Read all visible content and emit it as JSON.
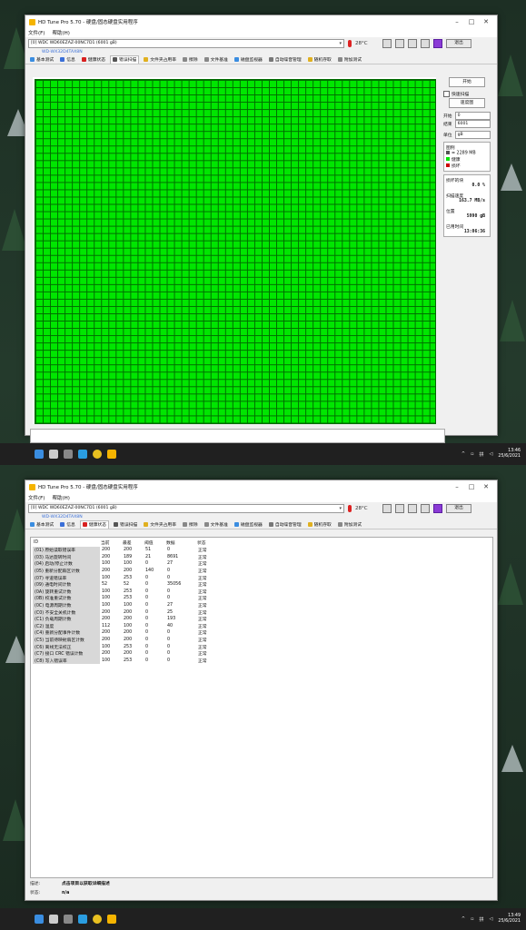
{
  "window_title": "HD Tune Pro 5.70 - 硬盘/固态硬盘实用程序",
  "menu": [
    "文件(F)",
    "帮助(H)"
  ],
  "drive": {
    "select": "[0]  WDC WD60EZAZ-00NC7D1  (6001 gB)",
    "temperature": "28°C",
    "serial": "WD-WX32D4TAX8N"
  },
  "exit_label": "退出",
  "tabs": [
    "基本测试",
    "信息",
    "健康状态",
    "错误扫描",
    "文件夹占用率",
    "擦除",
    "文件基准",
    "磁盘监视器",
    "自动噪音管理",
    "随机存取",
    "附加测试"
  ],
  "scan": {
    "start_button": "开始",
    "quick_scan": "快速扫描",
    "speed_map": "速度图",
    "start_label": "开始",
    "start_value": "0",
    "end_label": "结束",
    "end_value": "6001",
    "unit_label": "单位",
    "unit_value": "gB",
    "legend_title": "图例",
    "legend_block": "= 2289 MB",
    "legend_ok": "健康",
    "legend_bad": "损坏",
    "damaged_label": "损坏的块",
    "damaged_value": "0.0 %",
    "speed_label": "扫描速度",
    "speed_value": "163.7 MB/s",
    "position_label": "位置",
    "position_value": "5990 gB",
    "elapsed_label": "已用时间",
    "elapsed_value": "13:06:36",
    "colors": {
      "ok": "#00e600",
      "bad": "#cc0000",
      "grid": "#006b00"
    }
  },
  "health": {
    "columns": [
      "ID",
      "当前",
      "最差",
      "阈值",
      "数据",
      "状态"
    ],
    "rows": [
      [
        "(01) 原始读取错误率",
        "200",
        "200",
        "51",
        "0",
        "正常"
      ],
      [
        "(03) 马达旋转时间",
        "200",
        "189",
        "21",
        "8691",
        "正常"
      ],
      [
        "(04) 启动/停止计数",
        "100",
        "100",
        "0",
        "27",
        "正常"
      ],
      [
        "(05) 重新分配扇区计数",
        "200",
        "200",
        "140",
        "0",
        "正常"
      ],
      [
        "(07) 寻道错误率",
        "100",
        "253",
        "0",
        "0",
        "正常"
      ],
      [
        "(09) 通电时间计数",
        "52",
        "52",
        "0",
        "35056",
        "正常"
      ],
      [
        "(0A) 旋转重试计数",
        "100",
        "253",
        "0",
        "0",
        "正常"
      ],
      [
        "(0B) 校准重试计数",
        "100",
        "253",
        "0",
        "0",
        "正常"
      ],
      [
        "(0C) 电源周期计数",
        "100",
        "100",
        "0",
        "27",
        "正常"
      ],
      [
        "(C0) 不安全关机计数",
        "200",
        "200",
        "0",
        "25",
        "正常"
      ],
      [
        "(C1) 负载周期计数",
        "200",
        "200",
        "0",
        "193",
        "正常"
      ],
      [
        "(C2) 温度",
        "112",
        "100",
        "0",
        "40",
        "正常"
      ],
      [
        "(C4) 重新分配事件计数",
        "200",
        "200",
        "0",
        "0",
        "正常"
      ],
      [
        "(C5) 当前待映射扇区计数",
        "200",
        "200",
        "0",
        "0",
        "正常"
      ],
      [
        "(C6) 离线无法校正",
        "100",
        "253",
        "0",
        "0",
        "正常"
      ],
      [
        "(C7) 接口 CRC 错误计数",
        "200",
        "200",
        "0",
        "0",
        "正常"
      ],
      [
        "(C8) 写入错误率",
        "100",
        "253",
        "0",
        "0",
        "正常"
      ]
    ],
    "desc_label": "描述:",
    "desc_value": "点击项目以获取详细描述",
    "status_label": "状态:",
    "status_value": "n/a"
  },
  "taskbar": {
    "lang": "拼",
    "time": "13:46",
    "date": "25/6/2021",
    "time2": "13:49",
    "date2": "25/6/2021"
  }
}
